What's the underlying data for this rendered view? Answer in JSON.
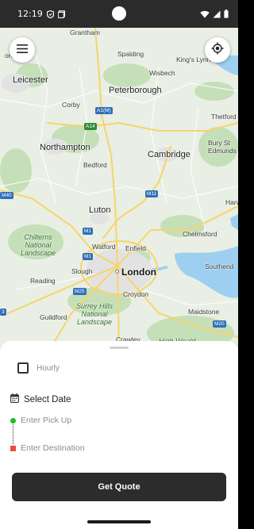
{
  "status_bar": {
    "time": "12:19",
    "left_icons": [
      "shield-icon",
      "sim-card-icon"
    ],
    "right_icons": [
      "wifi-icon",
      "signal-icon",
      "battery-icon"
    ]
  },
  "map": {
    "places": {
      "grantham": "Grantham",
      "borough": "orough",
      "spalding": "Spalding",
      "kings_lynn": "King's Lynn",
      "wisbech": "Wisbech",
      "leicester": "Leicester",
      "peterborough": "Peterborough",
      "corby": "Corby",
      "thetford": "Thetford",
      "bury_st_edmunds": "Bury St\nEdmunds",
      "northampton": "Northampton",
      "cambridge": "Cambridge",
      "bedford": "Bedford",
      "luton": "Luton",
      "chelmsford": "Chelmsford",
      "chilterns": "Chilterns\nNational\nLandscape",
      "watford": "Watford",
      "enfield": "Enfield",
      "slough": "Slough",
      "london": "London",
      "southend": "Southend",
      "reading": "Reading",
      "croydon": "Croydon",
      "surrey_hills": "Surrey Hills\nNational\nLandscape",
      "guildford": "Guildford",
      "maidstone": "Maidstone",
      "crawley": "Crawley",
      "high_weald": "High Weald",
      "harwich": "Harwi"
    },
    "roads": {
      "a1m": "A1(M)",
      "a14": "A14",
      "m1_north": "M1",
      "m11": "M11",
      "m40": "M40",
      "m1_south": "M1",
      "m25": "M25",
      "m20": "M20",
      "m3": "3"
    },
    "colors": {
      "land": "#e9efe4",
      "park": "#c5dfb8",
      "water": "#9ccff0",
      "urban": "#e2e2e2",
      "major_road": "#f7d46b"
    }
  },
  "buttons": {
    "menu_icon": "hamburger-menu-icon",
    "locate_icon": "my-location-icon"
  },
  "booking": {
    "hourly_label": "Hourly",
    "hourly_checked": false,
    "date_icon": "calendar-icon",
    "date_label": "Select Date",
    "pickup_placeholder": "Enter Pick Up",
    "destination_placeholder": "Enter Destination",
    "submit_label": "Get Quote",
    "accent_pickup": "#22b82a",
    "accent_destination": "#ef4a3c"
  }
}
